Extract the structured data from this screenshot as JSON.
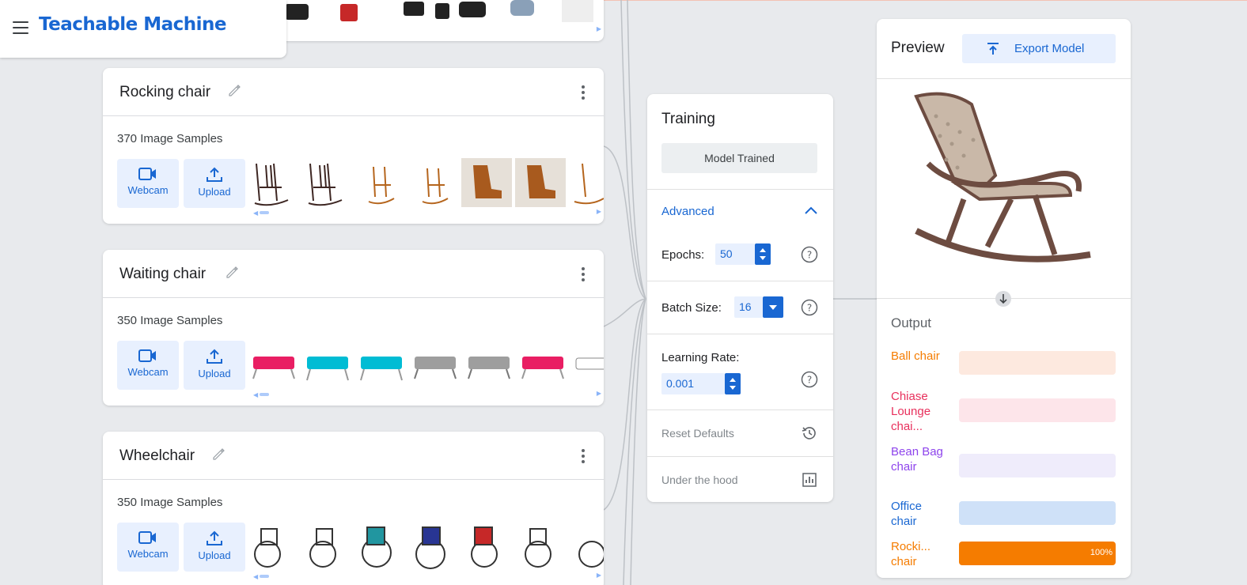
{
  "app": {
    "title": "Teachable Machine"
  },
  "classes": [
    {
      "name": "Rocking chair",
      "samples": "370 Image Samples",
      "webcam": "Webcam",
      "upload": "Upload"
    },
    {
      "name": "Waiting chair",
      "samples": "350 Image Samples",
      "webcam": "Webcam",
      "upload": "Upload"
    },
    {
      "name": "Wheelchair",
      "samples": "350 Image Samples",
      "webcam": "Webcam",
      "upload": "Upload"
    }
  ],
  "training": {
    "title": "Training",
    "status_button": "Model Trained",
    "advanced": "Advanced",
    "epochs_label": "Epochs:",
    "epochs_value": "50",
    "batch_label": "Batch Size:",
    "batch_value": "16",
    "lr_label": "Learning Rate:",
    "lr_value": "0.001",
    "reset": "Reset Defaults",
    "under_hood": "Under the hood"
  },
  "preview": {
    "title": "Preview",
    "export": "Export Model",
    "output_label": "Output",
    "outputs": [
      {
        "name": "Ball chair",
        "color": "#f57c00",
        "bg": "#fde9df",
        "value": 0
      },
      {
        "name": "Chiase Lounge chai...",
        "color": "#e8305c",
        "bg": "#fde5ea",
        "value": 0
      },
      {
        "name": "Bean Bag chair",
        "color": "#8e44ec",
        "bg": "#efecfb",
        "value": 0
      },
      {
        "name": "Office chair",
        "color": "#1967d2",
        "bg": "#cfe1f8",
        "value": 0
      },
      {
        "name": "Rocki... chair",
        "color": "#f57c00",
        "bg": "#fde9df",
        "value": 1.0,
        "pct": "100%"
      }
    ]
  }
}
